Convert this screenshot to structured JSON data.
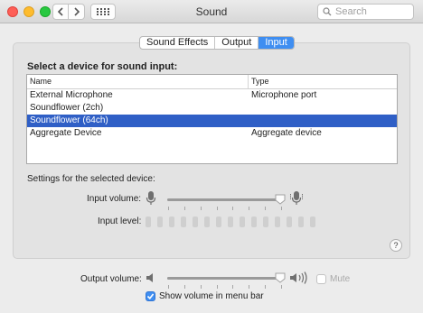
{
  "window": {
    "title": "Sound"
  },
  "search": {
    "placeholder": "Search"
  },
  "tabs": [
    {
      "label": "Sound Effects",
      "active": false
    },
    {
      "label": "Output",
      "active": false
    },
    {
      "label": "Input",
      "active": true
    }
  ],
  "input": {
    "heading": "Select a device for sound input:",
    "columns": {
      "name": "Name",
      "type": "Type"
    },
    "devices": [
      {
        "name": "External Microphone",
        "type": "Microphone port",
        "selected": false
      },
      {
        "name": "Soundflower (2ch)",
        "type": "",
        "selected": false
      },
      {
        "name": "Soundflower (64ch)",
        "type": "",
        "selected": true
      },
      {
        "name": "Aggregate Device",
        "type": "Aggregate device",
        "selected": false
      }
    ],
    "settings_label": "Settings for the selected device:",
    "volume_label": "Input volume:",
    "volume_fraction": 0.98,
    "level_label": "Input level:",
    "level_segments_lit": 0
  },
  "output": {
    "volume_label": "Output volume:",
    "volume_fraction": 0.98,
    "mute_label": "Mute",
    "mute_checked": false,
    "show_volume_label": "Show volume in menu bar",
    "show_volume_checked": true
  },
  "help_label": "?",
  "colors": {
    "accent": "#3f8ef1",
    "selection": "#2f5fc6"
  }
}
